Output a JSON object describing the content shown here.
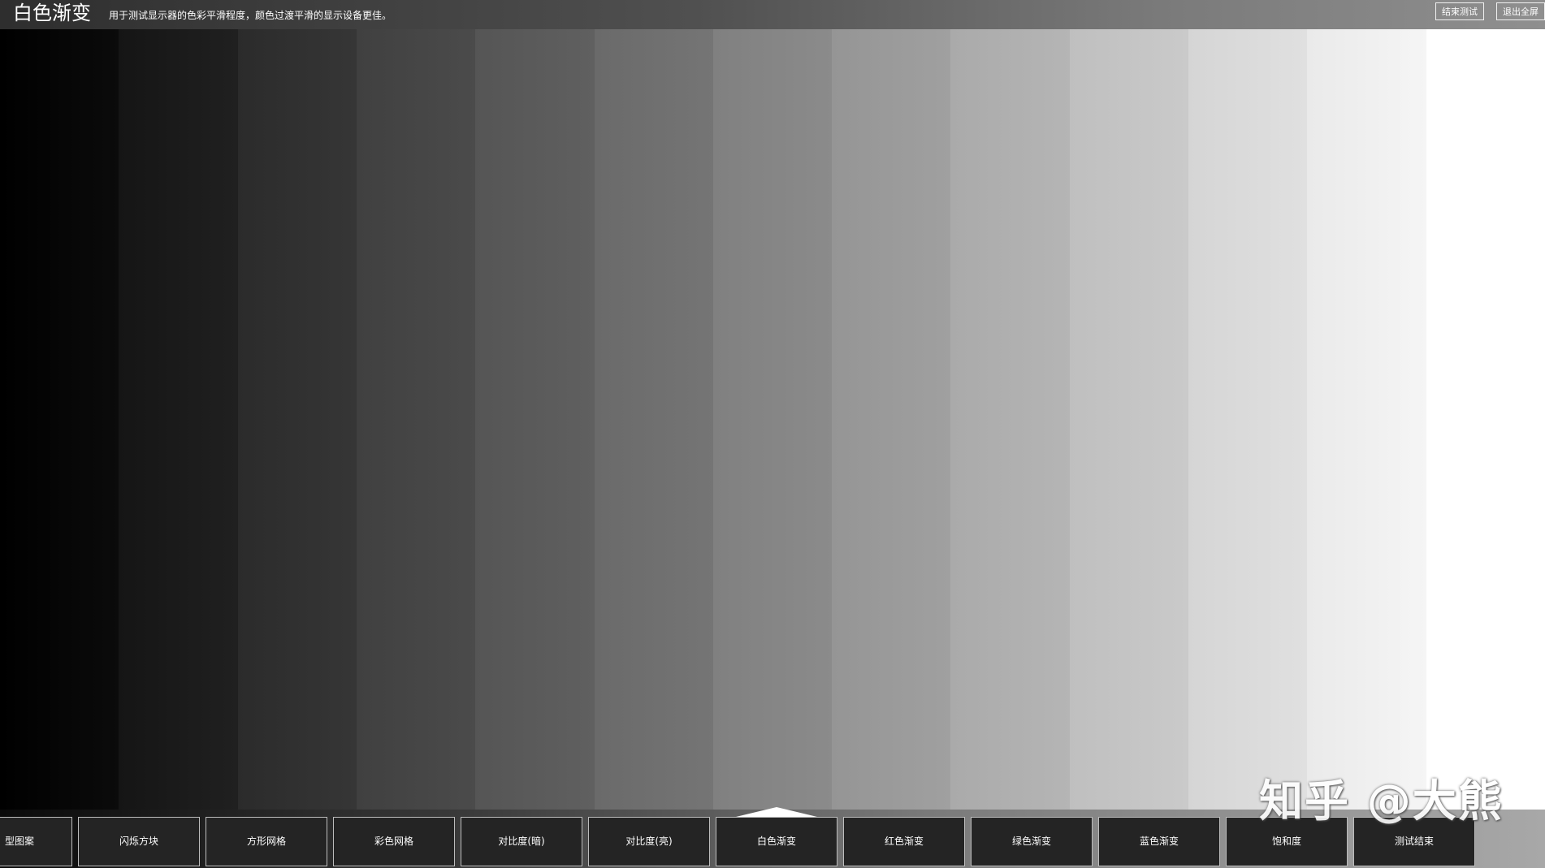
{
  "header": {
    "title": "白色渐变",
    "subtitle": "用于测试显示器的色彩平滑程度，颜色过渡平滑的显示设备更佳。",
    "end_test_label": "结束测试",
    "exit_fullscreen_label": "退出全屏"
  },
  "gradient": {
    "start_color": "#000000",
    "end_color": "#ffffff",
    "steps": 13
  },
  "nav": {
    "active_label": "白色渐变",
    "items": [
      {
        "label": "典型图案",
        "shown": "型图案"
      },
      {
        "label": "闪烁方块"
      },
      {
        "label": "方形网格"
      },
      {
        "label": "彩色网格"
      },
      {
        "label": "对比度(暗)"
      },
      {
        "label": "对比度(亮)"
      },
      {
        "label": "白色渐变"
      },
      {
        "label": "红色渐变"
      },
      {
        "label": "绿色渐变"
      },
      {
        "label": "蓝色渐变"
      },
      {
        "label": "饱和度"
      },
      {
        "label": "测试结束"
      }
    ]
  },
  "watermark": {
    "text": "知乎 @大熊"
  }
}
